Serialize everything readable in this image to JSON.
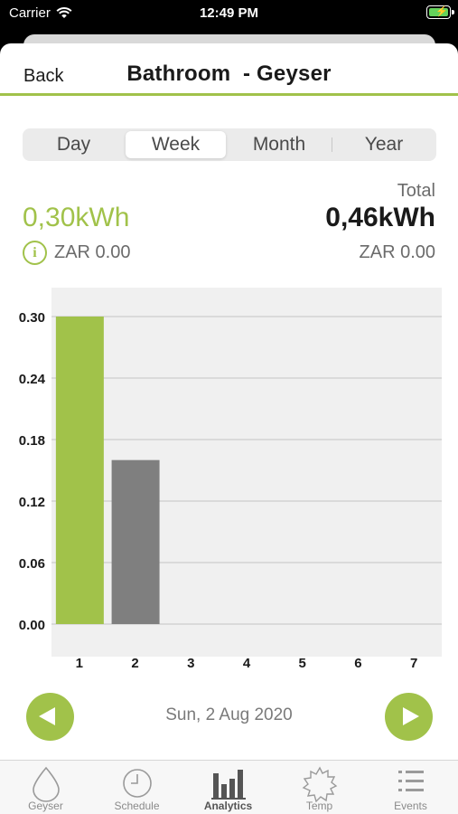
{
  "status_bar": {
    "carrier": "Carrier",
    "time": "12:49 PM"
  },
  "nav": {
    "back_label": "Back",
    "title": "Bathroom  - Geyser"
  },
  "segments": [
    "Day",
    "Week",
    "Month",
    "Year"
  ],
  "selected_segment": "Week",
  "summary": {
    "current_kwh": "0,30kWh",
    "current_zar": "ZAR 0.00",
    "total_label": "Total",
    "total_kwh": "0,46kWh",
    "total_zar": "ZAR 0.00"
  },
  "chart_data": {
    "type": "bar",
    "categories": [
      "1",
      "2",
      "3",
      "4",
      "5",
      "6",
      "7"
    ],
    "values": [
      0.3,
      0.16,
      0,
      0,
      0,
      0,
      0
    ],
    "bar_colors": [
      "#a1c24a",
      "#7f7f7f",
      "#7f7f7f",
      "#7f7f7f",
      "#7f7f7f",
      "#7f7f7f",
      "#7f7f7f"
    ],
    "yticks": [
      "0.00",
      "0.06",
      "0.12",
      "0.18",
      "0.24",
      "0.30"
    ],
    "ylim": [
      0,
      0.3
    ],
    "title": "",
    "xlabel": "",
    "ylabel": "",
    "grid": true
  },
  "date_nav": {
    "date": "Sun, 2 Aug 2020"
  },
  "tabs": [
    {
      "label": "Geyser",
      "icon": "droplet-icon"
    },
    {
      "label": "Schedule",
      "icon": "clock-icon"
    },
    {
      "label": "Analytics",
      "icon": "bar-chart-icon"
    },
    {
      "label": "Temp",
      "icon": "sun-icon"
    },
    {
      "label": "Events",
      "icon": "list-icon"
    }
  ],
  "active_tab": "Analytics",
  "colors": {
    "accent": "#a1c24a",
    "secondary_bar": "#7f7f7f"
  }
}
